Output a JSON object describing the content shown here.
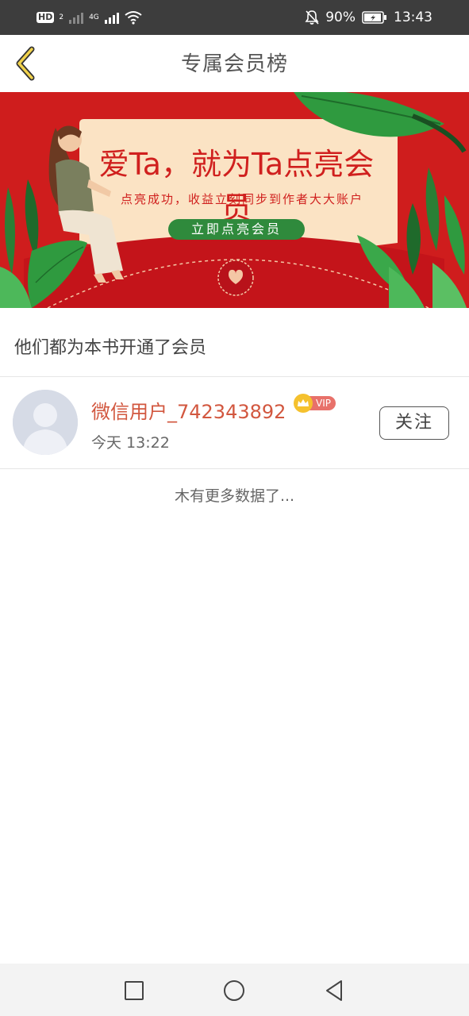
{
  "status_bar": {
    "hd_label": "HD",
    "hd_sub": "2",
    "network_label": "4G",
    "battery_percent": "90%",
    "time": "13:43"
  },
  "header": {
    "title": "专属会员榜"
  },
  "banner": {
    "title": "爱Ta，就为Ta点亮会员",
    "subtitle": "点亮成功，收益立刻同步到作者大大账户",
    "button_label": "立即点亮会员"
  },
  "section": {
    "title": "他们都为本书开通了会员"
  },
  "members": [
    {
      "name": "微信用户_742343892",
      "badge": "VIP",
      "time": "今天  13:22",
      "follow_label": "关注"
    }
  ],
  "list_end_text": "木有更多数据了...",
  "colors": {
    "status_bar_bg": "#3d3d3d",
    "banner_red": "#cf1d1d",
    "name_color": "#d2573f",
    "vip_pink": "#e8716a",
    "vip_gold": "#f5c12e",
    "button_green": "#2f8a3c"
  }
}
